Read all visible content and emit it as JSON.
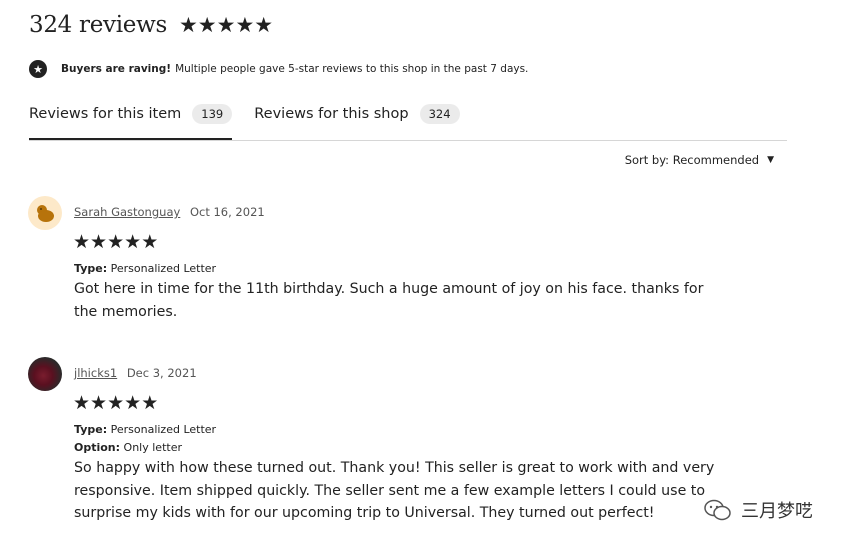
{
  "header": {
    "title": "324 reviews",
    "rating_stars": 5
  },
  "notice": {
    "bold": "Buyers are raving!",
    "text": "Multiple people gave 5-star reviews to this shop in the past 7 days."
  },
  "tabs": [
    {
      "label": "Reviews for this item",
      "count": "139",
      "active": true
    },
    {
      "label": "Reviews for this shop",
      "count": "324",
      "active": false
    }
  ],
  "sort": {
    "label": "Sort by: Recommended"
  },
  "reviews": [
    {
      "user": "Sarah Gastonguay",
      "date": "Oct 16, 2021",
      "rating": 5,
      "type_label": "Type:",
      "type_value": "Personalized Letter",
      "text": "Got here in time for the 11th birthday. Such a huge amount of joy on his face. thanks for the memories."
    },
    {
      "user": "jlhicks1",
      "date": "Dec 3, 2021",
      "rating": 5,
      "type_label": "Type:",
      "type_value": "Personalized Letter",
      "option_label": "Option:",
      "option_value": "Only letter",
      "text": "So happy with how these turned out. Thank you! This seller is great to work with and very responsive. Item shipped quickly. The seller sent me a few example letters I could use to surprise my kids with for our upcoming trip to Universal. They turned out perfect!"
    }
  ],
  "watermark": {
    "text": "三月梦呓"
  },
  "colors": {
    "text": "#222222",
    "badge_bg": "#ebebeb",
    "divider": "#d6d6d6",
    "avatar1_bg": "#fde9c9"
  }
}
